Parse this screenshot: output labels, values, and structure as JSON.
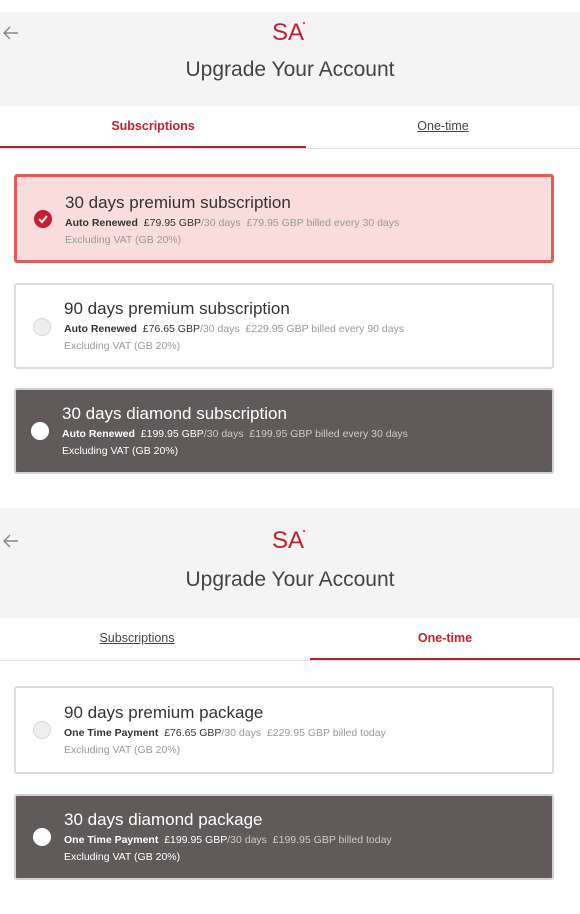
{
  "screens": [
    {
      "header": {
        "logo_text": "SA",
        "title": "Upgrade Your Account"
      },
      "tabs": [
        {
          "label": "Subscriptions",
          "active": true
        },
        {
          "label": "One-time",
          "active": false
        }
      ],
      "cards": [
        {
          "title": "30 days premium subscription",
          "payment_type": "Auto Renewed",
          "price": "£79.95 GBP",
          "period": "/30 days",
          "billing": "£79.95 GBP billed every 30 days",
          "vat": "Excluding VAT (GB 20%)",
          "state": "selected"
        },
        {
          "title": "90 days premium subscription",
          "payment_type": "Auto Renewed",
          "price": "£76.65 GBP",
          "period": "/30 days",
          "billing": "£229.95 GBP billed every 90 days",
          "vat": "Excluding VAT (GB 20%)",
          "state": "plain"
        },
        {
          "title": "30 days diamond subscription",
          "payment_type": "Auto Renewed",
          "price": "£199.95 GBP",
          "period": "/30 days",
          "billing": "£199.95 GBP billed every 30 days",
          "vat": "Excluding VAT (GB 20%)",
          "state": "dark"
        }
      ]
    },
    {
      "header": {
        "logo_text": "SA",
        "title": "Upgrade Your Account"
      },
      "tabs": [
        {
          "label": "Subscriptions",
          "active": false
        },
        {
          "label": "One-time",
          "active": true
        }
      ],
      "cards": [
        {
          "title": "90 days premium package",
          "payment_type": "One Time Payment",
          "price": "£76.65 GBP",
          "period": "/30 days",
          "billing": "£229.95 GBP billed today",
          "vat": "Excluding VAT (GB 20%)",
          "state": "plain"
        },
        {
          "title": "30 days diamond package",
          "payment_type": "One Time Payment",
          "price": "£199.95 GBP",
          "period": "/30 days",
          "billing": "£199.95 GBP billed today",
          "vat": "Excluding VAT (GB 20%)",
          "state": "dark"
        }
      ]
    }
  ],
  "colors": {
    "accent": "#c41e2e",
    "selected_bg": "#f9dcdc",
    "selected_border": "#e25c5c",
    "dark_card_bg": "#605a5a",
    "header_bg": "#f4f4f4"
  }
}
